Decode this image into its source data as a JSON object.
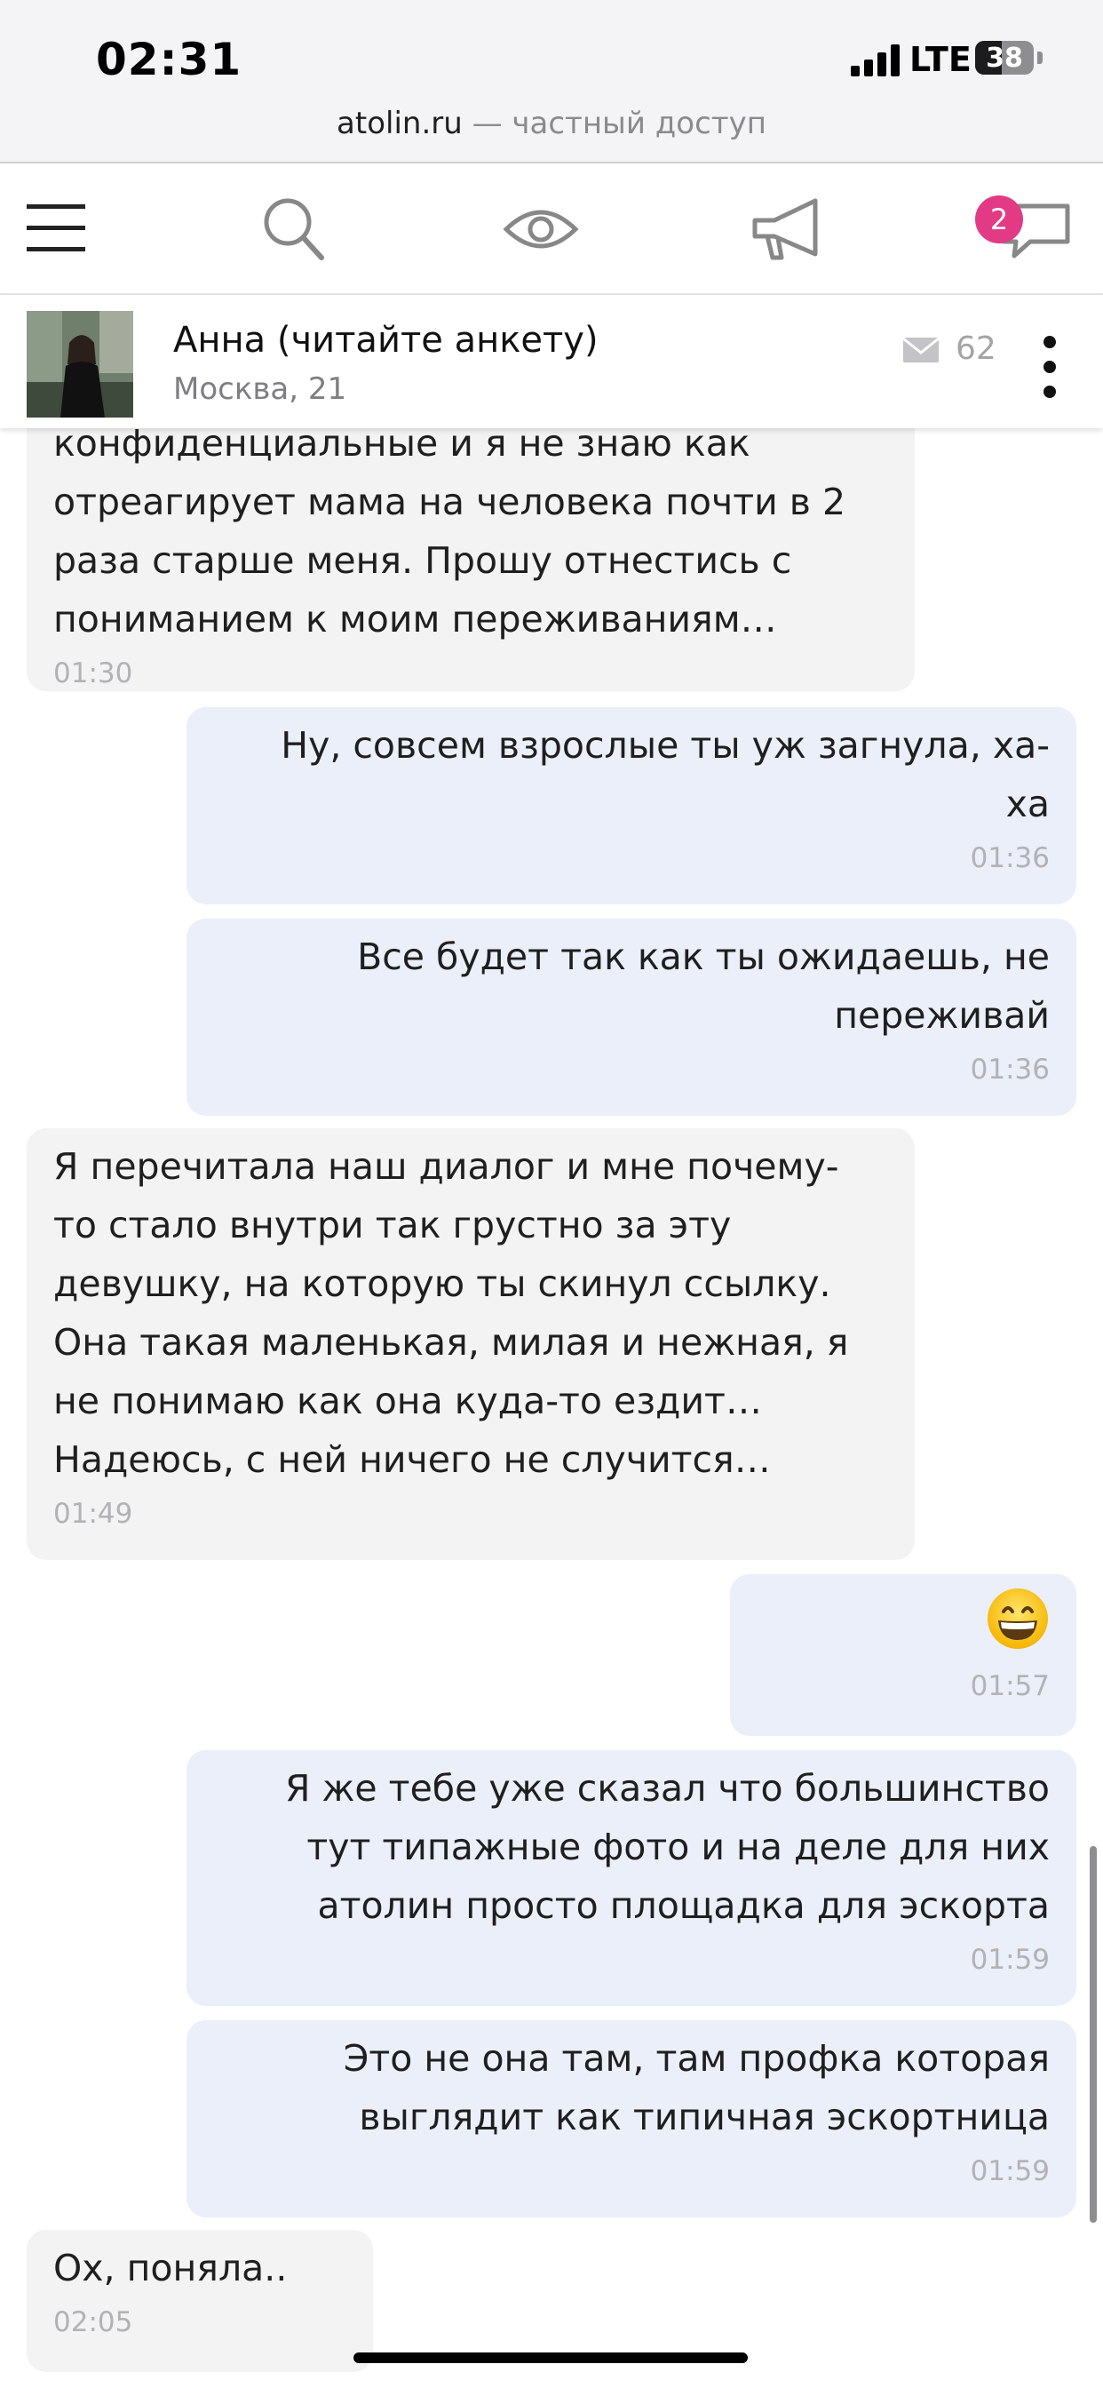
{
  "status_bar": {
    "time": "02:31",
    "network": "LTE",
    "battery": "38"
  },
  "url_bar": {
    "domain": "atolin.ru",
    "suffix": " — частный доступ"
  },
  "nav": {
    "icons": [
      "menu-icon",
      "search-icon",
      "eye-icon",
      "megaphone-icon",
      "chat-icon"
    ],
    "chat_badge": "2"
  },
  "contact": {
    "name": "Анна (читайте анкету)",
    "subtitle": "Москва, 21",
    "message_count": "62"
  },
  "messages": [
    {
      "side": "in",
      "text": "конфиденциальные и я не знаю как\nотреагирует мама на человека почти в 2\nраза старше меня. Прошу отнестись с\nпониманием к моим переживаниям…",
      "time": "01:30"
    },
    {
      "side": "out",
      "text": "Ну, совсем взрослые ты уж загнула, ха-\nха",
      "time": "01:36"
    },
    {
      "side": "out",
      "text": "Все будет так как ты ожидаешь, не\nпереживай",
      "time": "01:36"
    },
    {
      "side": "in",
      "text": "Я перечитала наш диалог и мне почему-\nто стало внутри так грустно за эту\nдевушку, на которую ты скинул ссылку.\nОна такая маленькая, милая и нежная, я\nне понимаю как она куда-то ездит…\nНадеюсь, с ней ничего не случится…",
      "time": "01:49"
    },
    {
      "side": "out",
      "emoji": "grinning-face-icon",
      "time": "01:57"
    },
    {
      "side": "out",
      "text": "Я же тебе уже сказал что большинство\nтут типажные фото и на деле для них\nатолин просто площадка для эскорта",
      "time": "01:59"
    },
    {
      "side": "out",
      "text": "Это не она там, там профка которая\nвыглядит как типичная эскортница",
      "time": "01:59"
    },
    {
      "side": "in",
      "text": "Ох, поняла..",
      "time": "02:05"
    }
  ],
  "colors": {
    "accent": "#e33a85",
    "incoming_bubble": "#f3f3f3",
    "outgoing_bubble": "#eaeff9",
    "timestamp": "#b2b2b6"
  }
}
